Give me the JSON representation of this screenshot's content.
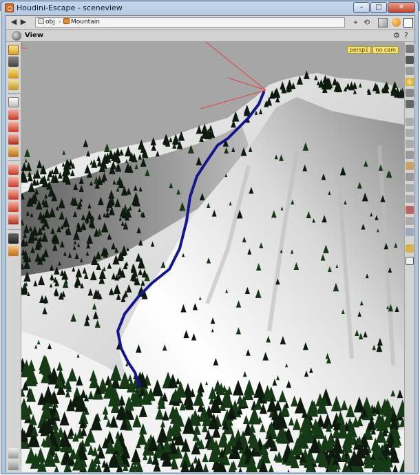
{
  "window": {
    "title": "Houdini-Escape - sceneview",
    "controls": {
      "minimize": "–",
      "maximize": "□",
      "close": "✕"
    }
  },
  "path": {
    "crumbs": [
      {
        "label": "obj",
        "icon": "object-level-icon",
        "color": "#e0e0e0"
      },
      {
        "label": "Mountain",
        "icon": "geometry-node-icon",
        "color": "#e98b2a"
      }
    ]
  },
  "pane": {
    "label": "View"
  },
  "viewport": {
    "camera_menu": "persp1",
    "cam_menu": "no cam"
  },
  "colors": {
    "sky": "#a6a6a6",
    "trail": "#1a1a9a",
    "tree_dark": "#0e1a0e",
    "tree_green": "#163a16",
    "guide_line": "#e24040"
  }
}
